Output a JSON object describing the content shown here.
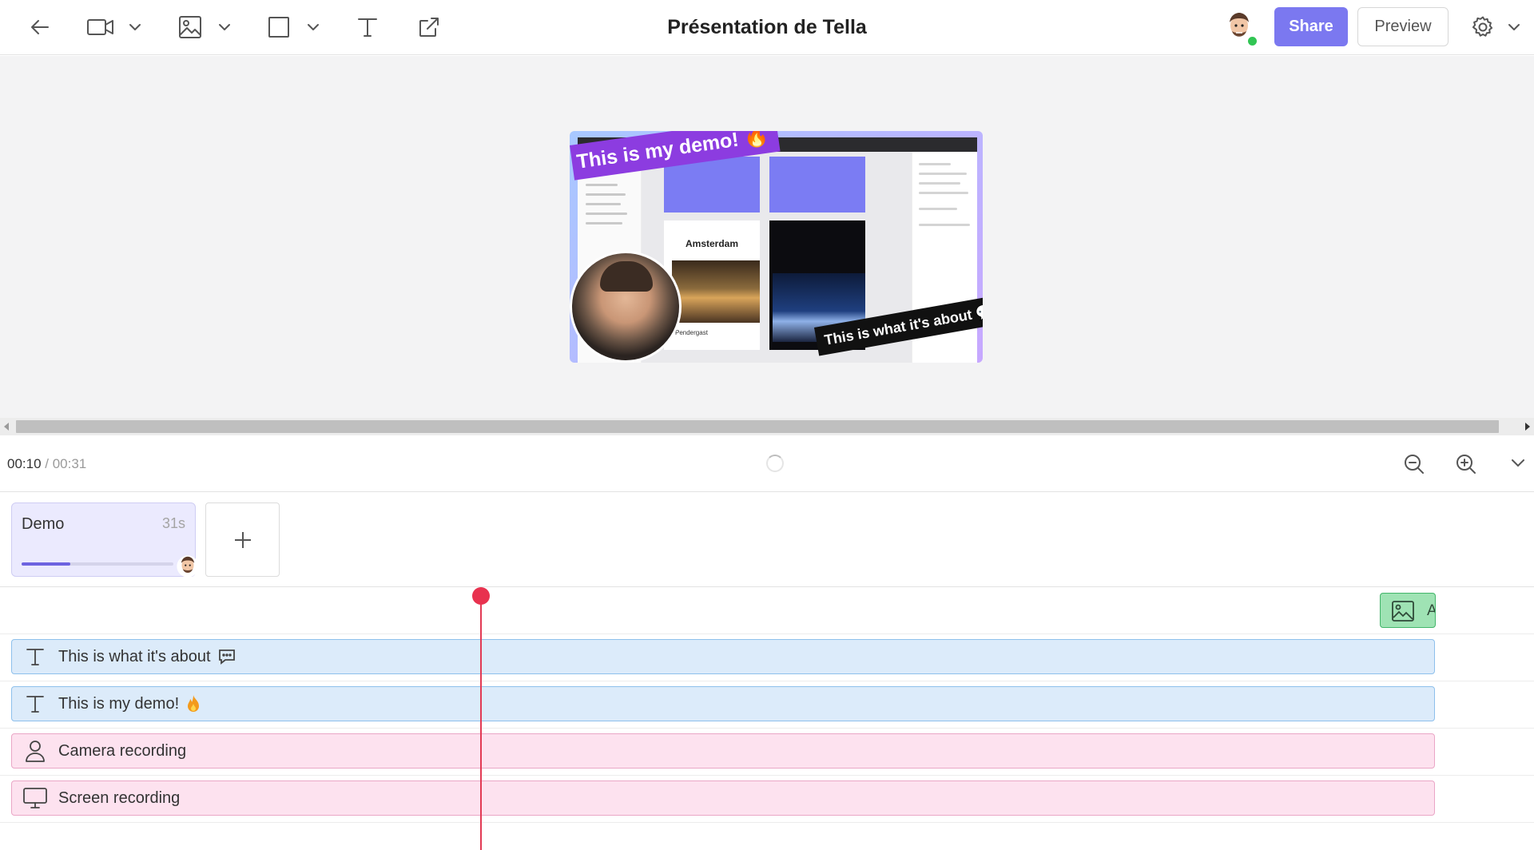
{
  "toolbar": {
    "title": "Présentation de Tella",
    "share_label": "Share",
    "preview_label": "Preview",
    "icons": [
      "back-arrow-icon",
      "video-camera-icon",
      "image-icon",
      "shape-square-icon",
      "text-icon",
      "external-link-icon",
      "settings-gear-icon"
    ]
  },
  "preview": {
    "overlay_title": "This is my demo! 🔥",
    "overlay_subtitle": "This is what it's about 💬",
    "city_label": "Amsterdam",
    "place_label": "Pendergast"
  },
  "timeline": {
    "current_time": "00:10",
    "separator": " / ",
    "total_time": "00:31",
    "playhead_fraction": 0.32
  },
  "clips": [
    {
      "name": "Demo",
      "duration": "31s",
      "progress": 0.32
    }
  ],
  "tracks": {
    "image_chip_label": "A",
    "items": [
      {
        "label": "This is what it's about",
        "type": "text",
        "emoji": "speech-bubble-icon"
      },
      {
        "label": "This is my demo!",
        "type": "text",
        "emoji": "fire-icon"
      },
      {
        "label": "Camera recording",
        "type": "camera"
      },
      {
        "label": "Screen recording",
        "type": "screen"
      }
    ]
  },
  "colors": {
    "accent": "#7b78f0",
    "text_track": "#dcebfa",
    "media_track": "#fde2ef",
    "image_chip": "#9fe3b4",
    "playhead": "#e8324f",
    "online": "#31c553"
  }
}
